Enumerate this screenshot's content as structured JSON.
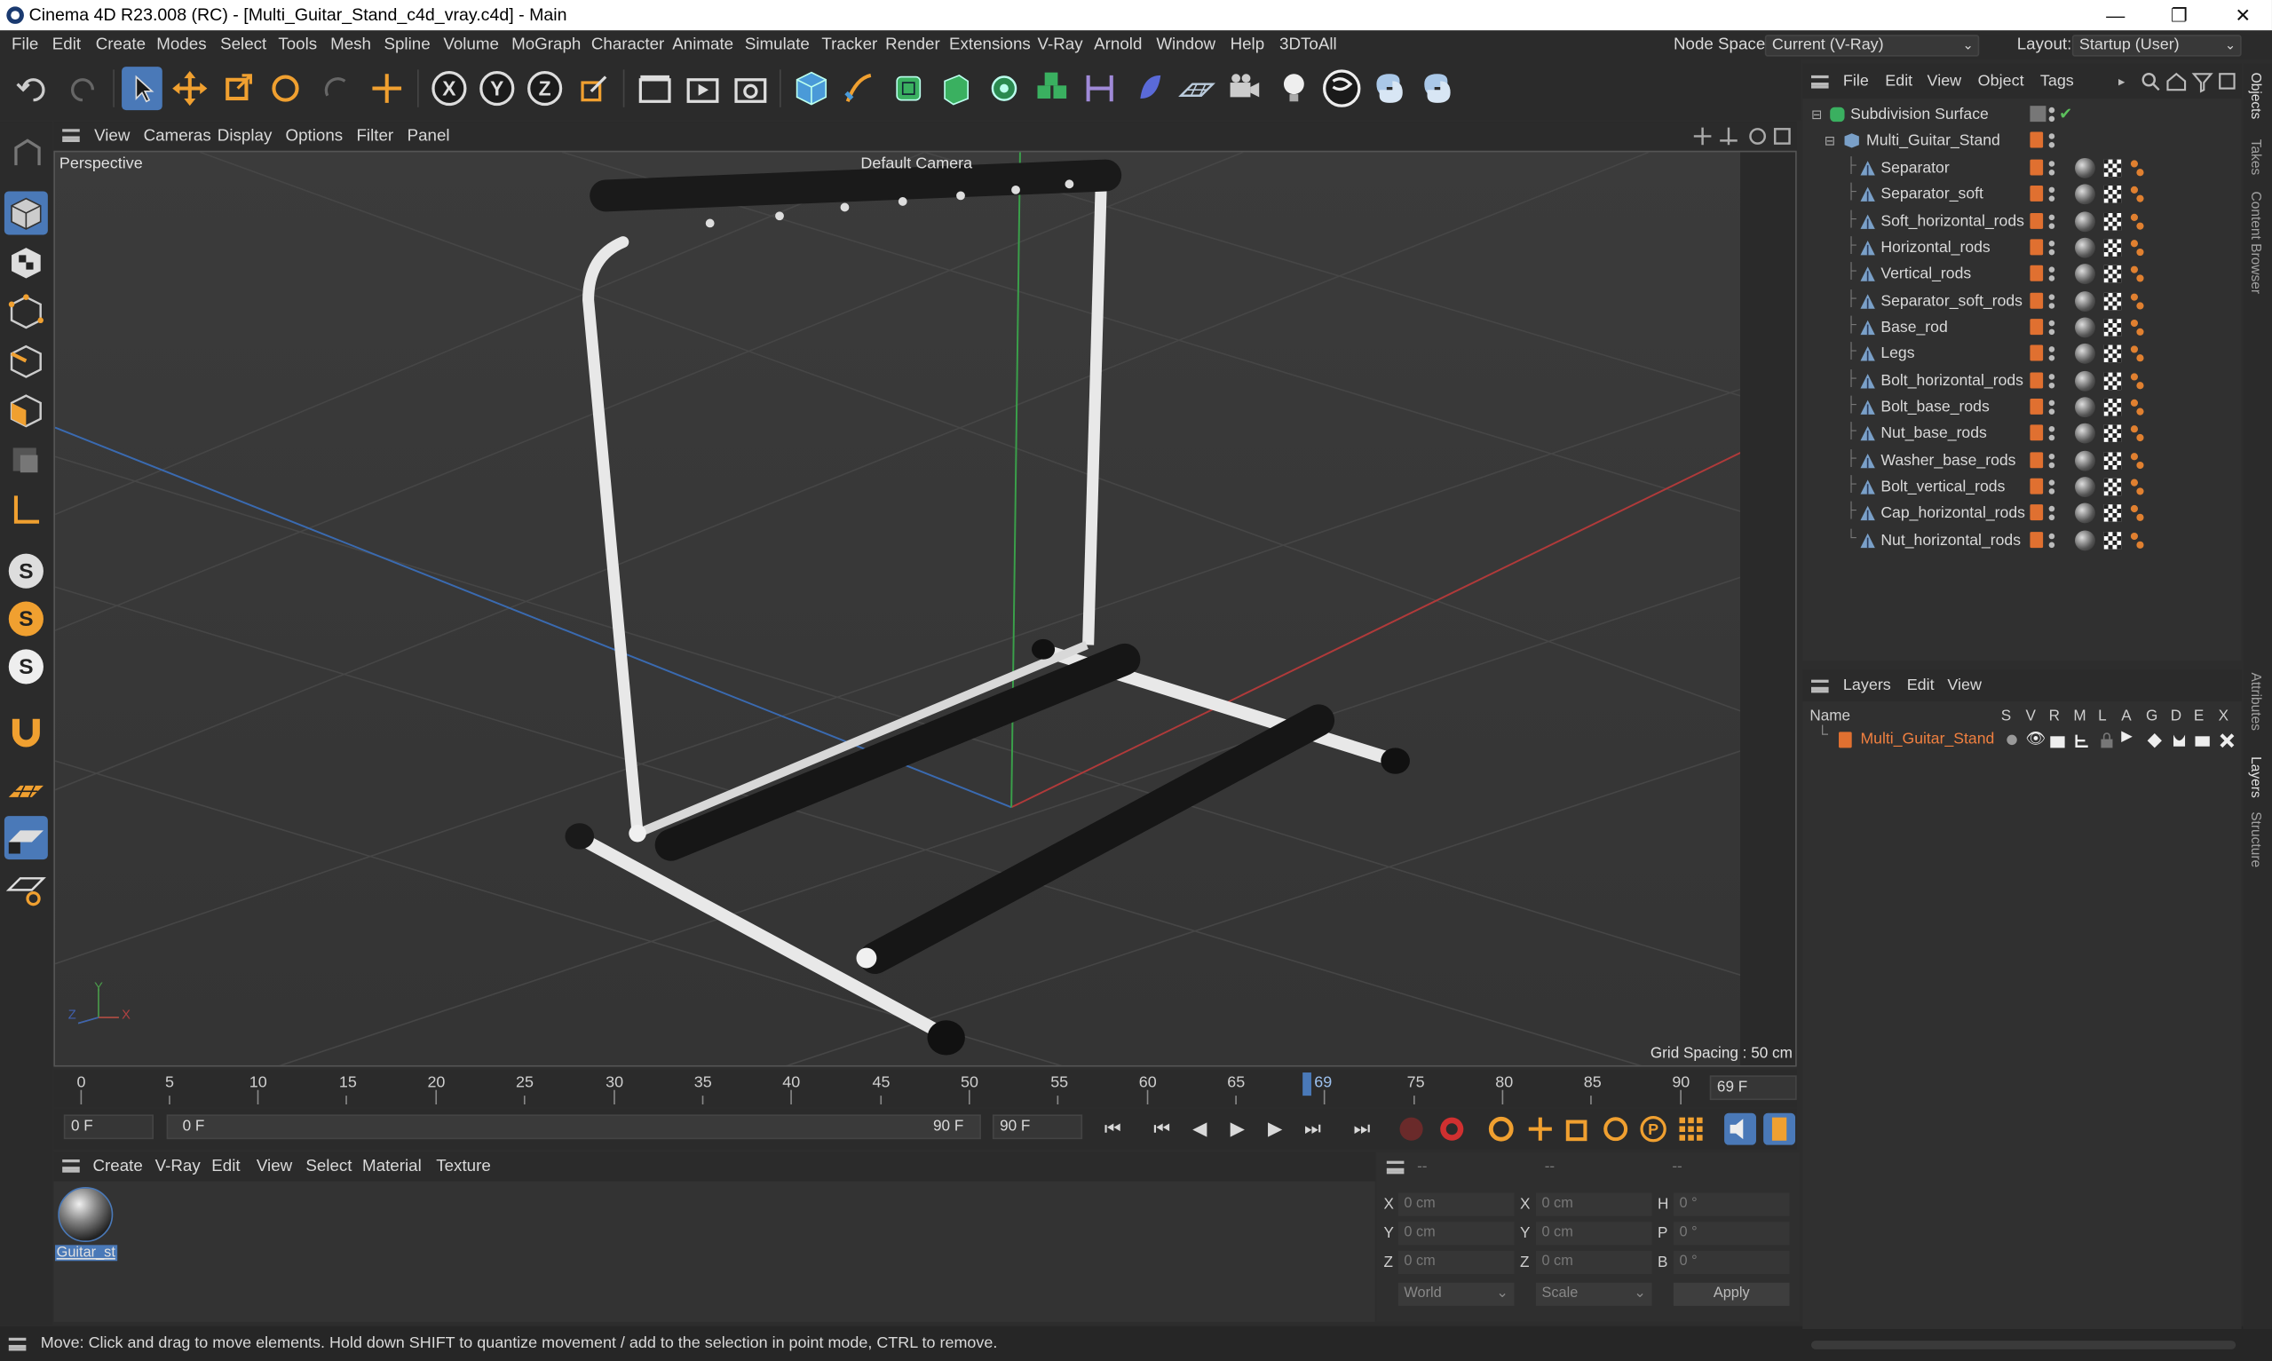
{
  "window": {
    "title": "Cinema 4D R23.008 (RC) - [Multi_Guitar_Stand_c4d_vray.c4d] - Main"
  },
  "menubar": {
    "items": [
      "File",
      "Edit",
      "Create",
      "Modes",
      "Select",
      "Tools",
      "Mesh",
      "Spline",
      "Volume",
      "MoGraph",
      "Character",
      "Animate",
      "Simulate",
      "Tracker",
      "Render",
      "Extensions",
      "V-Ray",
      "Arnold",
      "Window",
      "Help",
      "3DToAll"
    ],
    "node_space_label": "Node Space:",
    "node_space_value": "Current (V-Ray)",
    "layout_label": "Layout:",
    "layout_value": "Startup (User)"
  },
  "viewport_menu": {
    "items": [
      "View",
      "Cameras",
      "Display",
      "Options",
      "Filter",
      "Panel"
    ]
  },
  "viewport": {
    "view_name": "Perspective",
    "camera": "Default Camera",
    "grid_spacing": "Grid Spacing : 50 cm",
    "axis_labels": [
      "Y",
      "Z",
      "X"
    ]
  },
  "timeline": {
    "ticks": [
      "0",
      "5",
      "10",
      "15",
      "20",
      "25",
      "30",
      "35",
      "40",
      "45",
      "50",
      "55",
      "60",
      "65",
      "69",
      "75",
      "80",
      "85",
      "90"
    ],
    "end_field": "69 F",
    "current_frame": "0 F",
    "range_start": "0 F",
    "range_end": "90 F",
    "max_frame": "90 F"
  },
  "material_menu": {
    "items": [
      "Create",
      "V-Ray",
      "Edit",
      "View",
      "Select",
      "Material",
      "Texture"
    ]
  },
  "materials": [
    {
      "name": "Guitar_st"
    }
  ],
  "coords": {
    "header": [
      "--",
      "--",
      "--"
    ],
    "rows": [
      {
        "a": "X",
        "v1": "0 cm",
        "b": "X",
        "v2": "0 cm",
        "c": "H",
        "v3": "0 °"
      },
      {
        "a": "Y",
        "v1": "0 cm",
        "b": "Y",
        "v2": "0 cm",
        "c": "P",
        "v3": "0 °"
      },
      {
        "a": "Z",
        "v1": "0 cm",
        "b": "Z",
        "v2": "0 cm",
        "c": "B",
        "v3": "0 °"
      }
    ],
    "world": "World",
    "scale": "Scale",
    "apply": "Apply"
  },
  "status": {
    "text": "Move: Click and drag to move elements. Hold down SHIFT to quantize movement / add to the selection in point mode, CTRL to remove."
  },
  "objects_menu": {
    "items": [
      "File",
      "Edit",
      "View",
      "Object",
      "Tags"
    ]
  },
  "objects": {
    "root": "Subdivision Surface",
    "group": "Multi_Guitar_Stand",
    "children": [
      "Separator",
      "Separator_soft",
      "Soft_horizontal_rods",
      "Horizontal_rods",
      "Vertical_rods",
      "Separator_soft_rods",
      "Base_rod",
      "Legs",
      "Bolt_horizontal_rods",
      "Bolt_base_rods",
      "Nut_base_rods",
      "Washer_base_rods",
      "Bolt_vertical_rods",
      "Cap_horizontal_rods",
      "Nut_horizontal_rods"
    ]
  },
  "layers_menu": {
    "items": [
      "Layers",
      "Edit",
      "View"
    ]
  },
  "layers": {
    "columns": [
      "Name",
      "S",
      "V",
      "R",
      "M",
      "L",
      "A",
      "G",
      "D",
      "E",
      "X"
    ],
    "rows": [
      {
        "name": "Multi_Guitar_Stand"
      }
    ]
  },
  "side_tabs": [
    "Objects",
    "Takes",
    "Content Browser",
    "Attributes",
    "Layers",
    "Structure"
  ],
  "colors": {
    "accent": "#e07030",
    "selection": "#4a79b8",
    "background": "#2d2d2d"
  }
}
